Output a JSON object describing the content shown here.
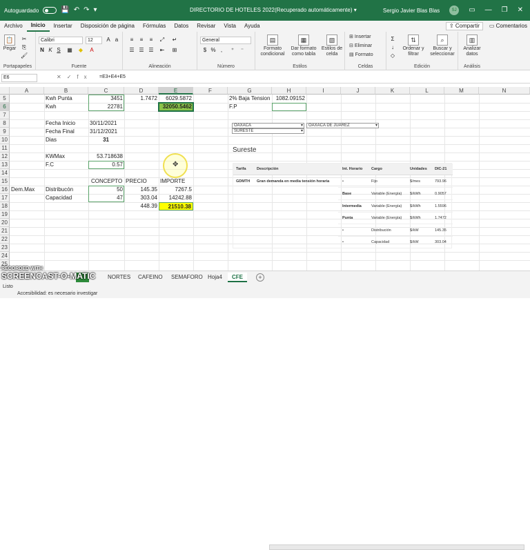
{
  "titlebar": {
    "autosave": "Autoguardado",
    "doc_title": "DIRECTORIO DE HOTELES 2022(Recuperado automáticamente)",
    "user": "Sergio Javier Blas Blas",
    "initials": "SJ"
  },
  "menu": [
    "Archivo",
    "Inicio",
    "Insertar",
    "Disposición de página",
    "Fórmulas",
    "Datos",
    "Revisar",
    "Vista",
    "Ayuda"
  ],
  "share": "Compartir",
  "comments": "Comentarios",
  "ribbon": {
    "paste": "Pegar",
    "font_name": "Calibri",
    "font_size": "12",
    "number_format": "General",
    "cond_format": "Formato condicional",
    "table_format": "Dar formato como tabla",
    "cell_styles": "Estilos de celda",
    "insert": "Insertar",
    "delete": "Eliminar",
    "format": "Formato",
    "sort": "Ordenar y filtrar",
    "find": "Buscar y seleccionar",
    "analyze": "Analizar datos",
    "groups": [
      "Portapapeles",
      "Fuente",
      "Alineación",
      "Número",
      "Estilos",
      "Celdas",
      "Edición",
      "Análisis"
    ]
  },
  "formula_bar": {
    "name_box": "E6",
    "formula": "=E3+E4+E5"
  },
  "columns": [
    "A",
    "B",
    "C",
    "D",
    "E",
    "F",
    "G",
    "H",
    "I",
    "J",
    "K",
    "L",
    "M",
    "N"
  ],
  "rows": [
    "5",
    "6",
    "7",
    "8",
    "9",
    "10",
    "11",
    "12",
    "13",
    "14",
    "15",
    "16",
    "17",
    "18",
    "19",
    "20",
    "21",
    "22",
    "23",
    "24",
    "25"
  ],
  "cells": {
    "b5": "Kwh Punta",
    "c5": "3451",
    "d5": "1.7472",
    "e5": "6029.5872",
    "g5": "2% Baja Tension",
    "h5": "1082.09152",
    "b6": "Kwh",
    "c6": "22781",
    "e6": "32050.5462",
    "g6": "F.P",
    "b8": "Fecha Inicio",
    "c8": "30/11/2021",
    "b9": "Fecha Final",
    "c9": "31/12/2021",
    "b10": "Dias",
    "c10": "31",
    "b12": "KWMax",
    "c12": "53.718638",
    "b13": "F.C",
    "c13": "0.57",
    "c15": "CONCEPTO",
    "d15": "PRECIO",
    "e15": "IMPORTE",
    "a16": "Dem.Max",
    "b16": "Distribucón",
    "c16": "50",
    "d16": "145.35",
    "e16": "7267.5",
    "b17": "Capacidad",
    "c17": "47",
    "d17": "303.04",
    "e17": "14242.88",
    "d18": "448.39",
    "e18": "21510.38"
  },
  "embedded": {
    "dd1": "OAXACA",
    "dd2": "OAXACA DE JUAREZ",
    "dd3": "SURESTE",
    "title": "Sureste",
    "headers": [
      "Tarifa",
      "Descripción",
      "Int. Horario",
      "Cargo",
      "Unidades",
      "DIC-21"
    ],
    "tarifa": "GDMTH",
    "descripcion": "Gran demanda en media tensión horaria",
    "rows": [
      {
        "int": "•",
        "cargo": "Fijo",
        "unidad": "$/mes",
        "valor": "793.96"
      },
      {
        "int": "Base",
        "cargo": "Variable (Energía)",
        "unidad": "$/kWh",
        "valor": "0.9057"
      },
      {
        "int": "Intermedia",
        "cargo": "Variable (Energía)",
        "unidad": "$/kWh",
        "valor": "1.5596"
      },
      {
        "int": "Punta",
        "cargo": "Variable (Energía)",
        "unidad": "$/kWh",
        "valor": "1.7472"
      },
      {
        "int": "•",
        "cargo": "Distribución",
        "unidad": "$/kW",
        "valor": "145.35"
      },
      {
        "int": "•",
        "cargo": "Capacidad",
        "unidad": "$/kW",
        "valor": "303.04"
      }
    ]
  },
  "tabs": [
    "NORTES",
    "CAFEINO",
    "SEMAFORO",
    "Hoja4",
    "CFE"
  ],
  "status": {
    "ready": "Listo",
    "accessibility": "Accesibilidad: es necesario investigar"
  },
  "watermark": {
    "line1": "RECORDED WITH",
    "line2": "SCREENCAST-O-MATIC"
  }
}
